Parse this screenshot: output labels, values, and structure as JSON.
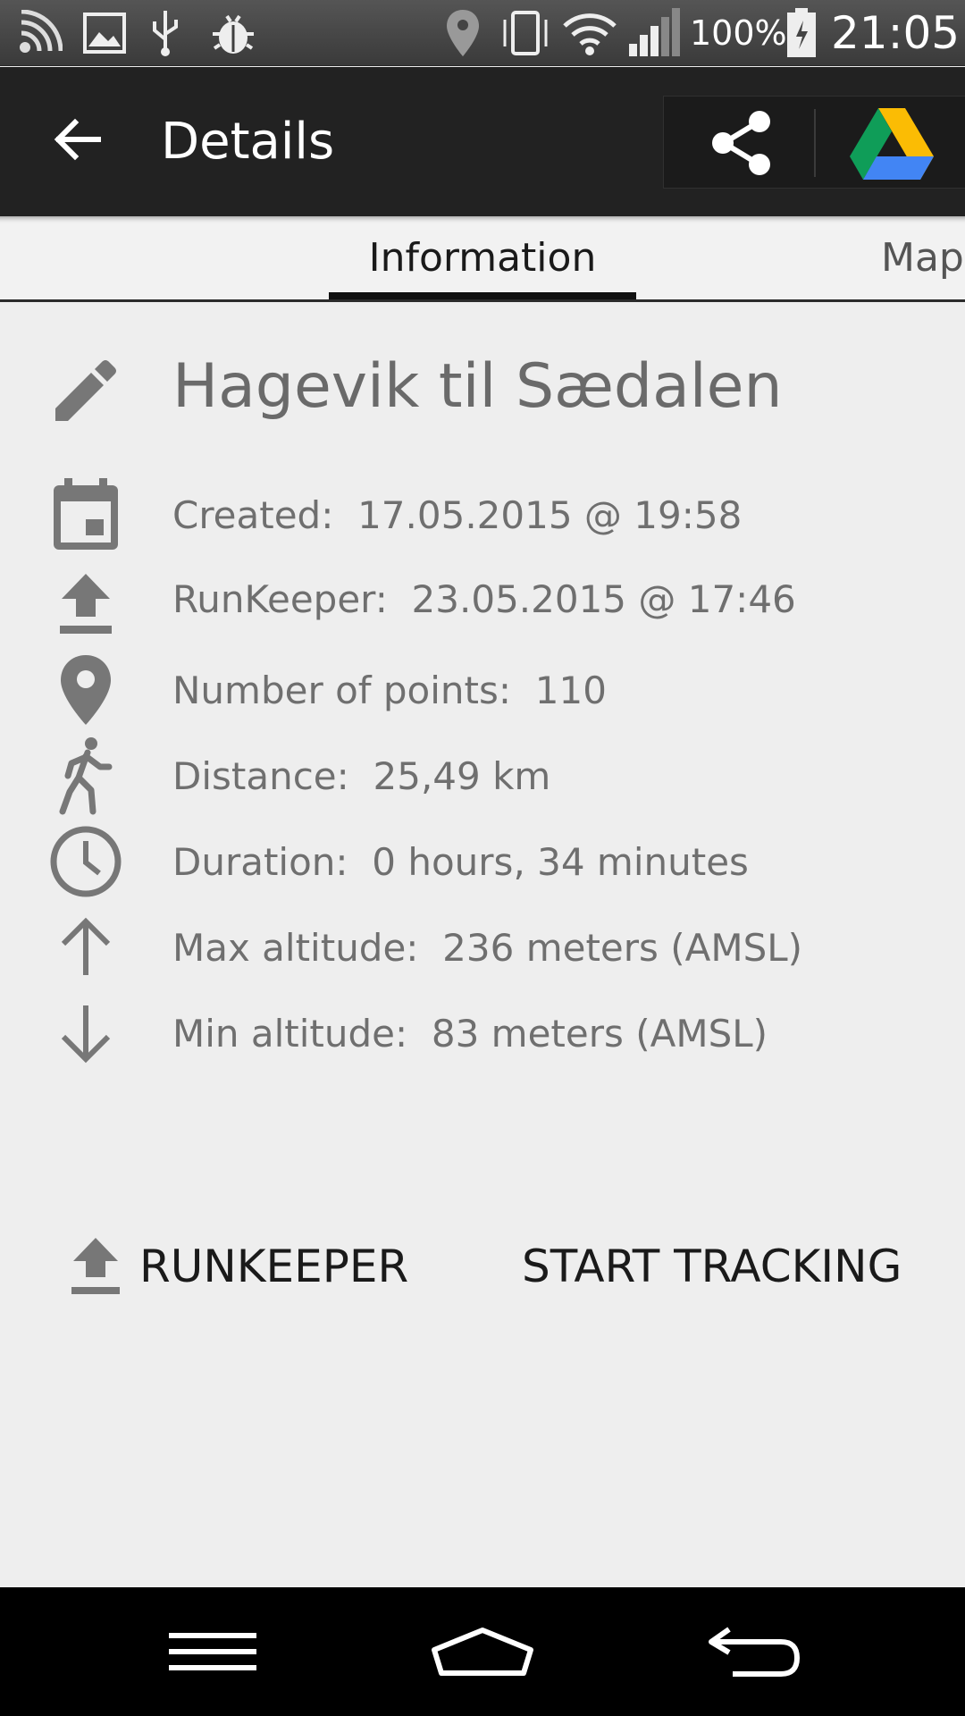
{
  "status_bar": {
    "icons": [
      "cast-icon",
      "image-icon",
      "usb-icon",
      "bug-icon",
      "location-icon",
      "vibrate-icon",
      "wifi-icon",
      "signal-icon",
      "battery-charging-icon"
    ],
    "battery": "100%",
    "time": "21:05"
  },
  "app_bar": {
    "title": "Details",
    "actions": [
      "share-icon",
      "google-drive-icon"
    ]
  },
  "tabs": [
    {
      "label": "Information",
      "selected": true
    },
    {
      "label": "Map",
      "selected": false
    }
  ],
  "track": {
    "name": "Hagevik til Sædalen",
    "details": [
      {
        "icon": "calendar-icon",
        "label": "Created:",
        "value": "17.05.2015 @ 19:58"
      },
      {
        "icon": "upload-icon",
        "label": "RunKeeper:",
        "value": "23.05.2015 @ 17:46"
      },
      {
        "icon": "location-pin-icon",
        "label": "Number of points:",
        "value": "110"
      },
      {
        "icon": "walking-icon",
        "label": "Distance:",
        "value": "25,49 km"
      },
      {
        "icon": "clock-icon",
        "label": "Duration:",
        "value": "0 hours, 34 minutes"
      },
      {
        "icon": "arrow-up-icon",
        "label": "Max altitude:",
        "value": "236 meters (AMSL)"
      },
      {
        "icon": "arrow-down-icon",
        "label": "Min altitude:",
        "value": "83 meters (AMSL)"
      }
    ]
  },
  "actions": {
    "runkeeper": "RUNKEEPER",
    "start_tracking": "START TRACKING"
  },
  "nav_bar": {
    "buttons": [
      "menu-icon",
      "home-icon",
      "back-icon"
    ]
  }
}
